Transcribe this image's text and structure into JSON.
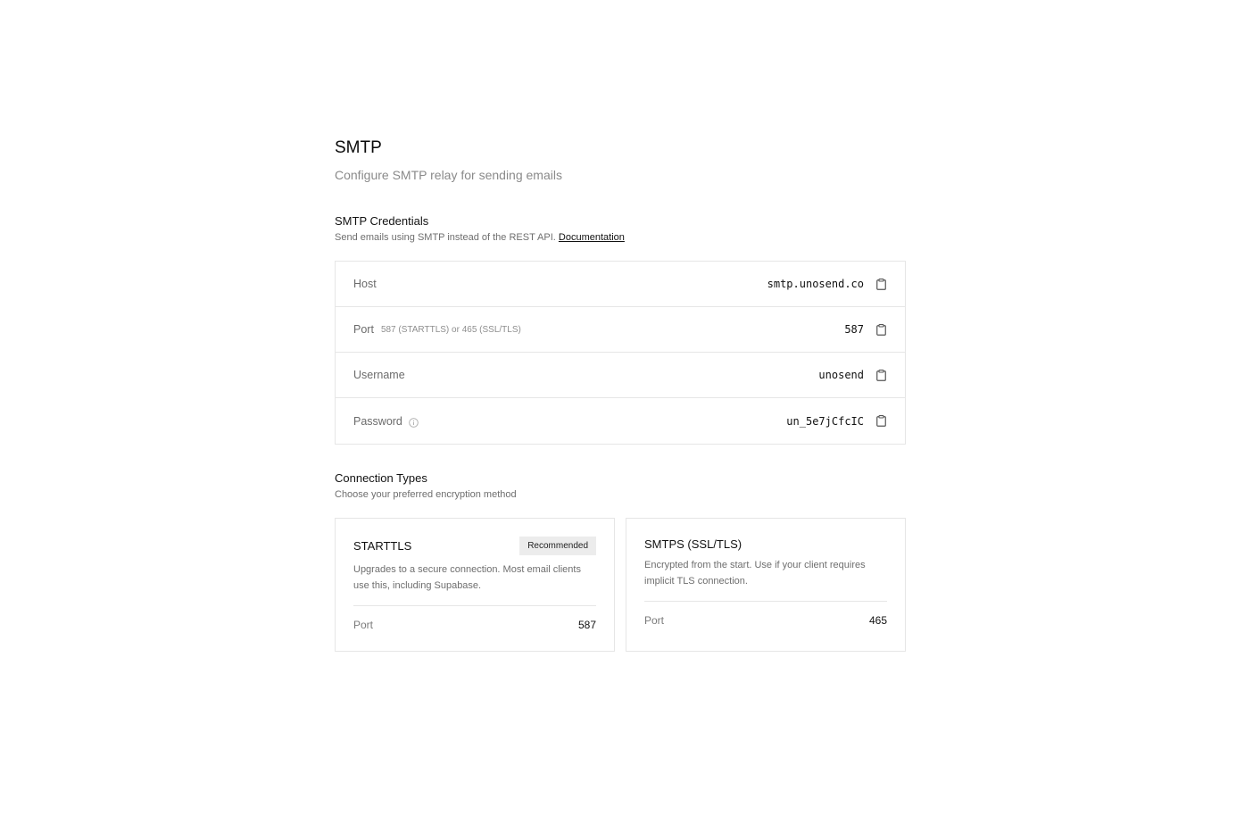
{
  "header": {
    "title": "SMTP",
    "subtitle": "Configure SMTP relay for sending emails"
  },
  "credentials": {
    "title": "SMTP Credentials",
    "description": "Send emails using SMTP instead of the REST API.",
    "doc_link": "Documentation",
    "rows": [
      {
        "label": "Host",
        "hint": "",
        "value": "smtp.unosend.co"
      },
      {
        "label": "Port",
        "hint": "587 (STARTTLS) or 465 (SSL/TLS)",
        "value": "587"
      },
      {
        "label": "Username",
        "hint": "",
        "value": "unosend"
      },
      {
        "label": "Password",
        "hint": "",
        "value": "un_5e7jCfcIC"
      }
    ]
  },
  "connection": {
    "title": "Connection Types",
    "description": "Choose your preferred encryption method",
    "cards": [
      {
        "title": "STARTTLS",
        "badge": "Recommended",
        "description": "Upgrades to a secure connection. Most email clients use this, including Supabase.",
        "port_label": "Port",
        "port_value": "587"
      },
      {
        "title": "SMTPS (SSL/TLS)",
        "badge": "",
        "description": "Encrypted from the start. Use if your client requires implicit TLS connection.",
        "port_label": "Port",
        "port_value": "465"
      }
    ]
  },
  "icons": {
    "copy": "clipboard-icon",
    "info": "info-icon"
  }
}
